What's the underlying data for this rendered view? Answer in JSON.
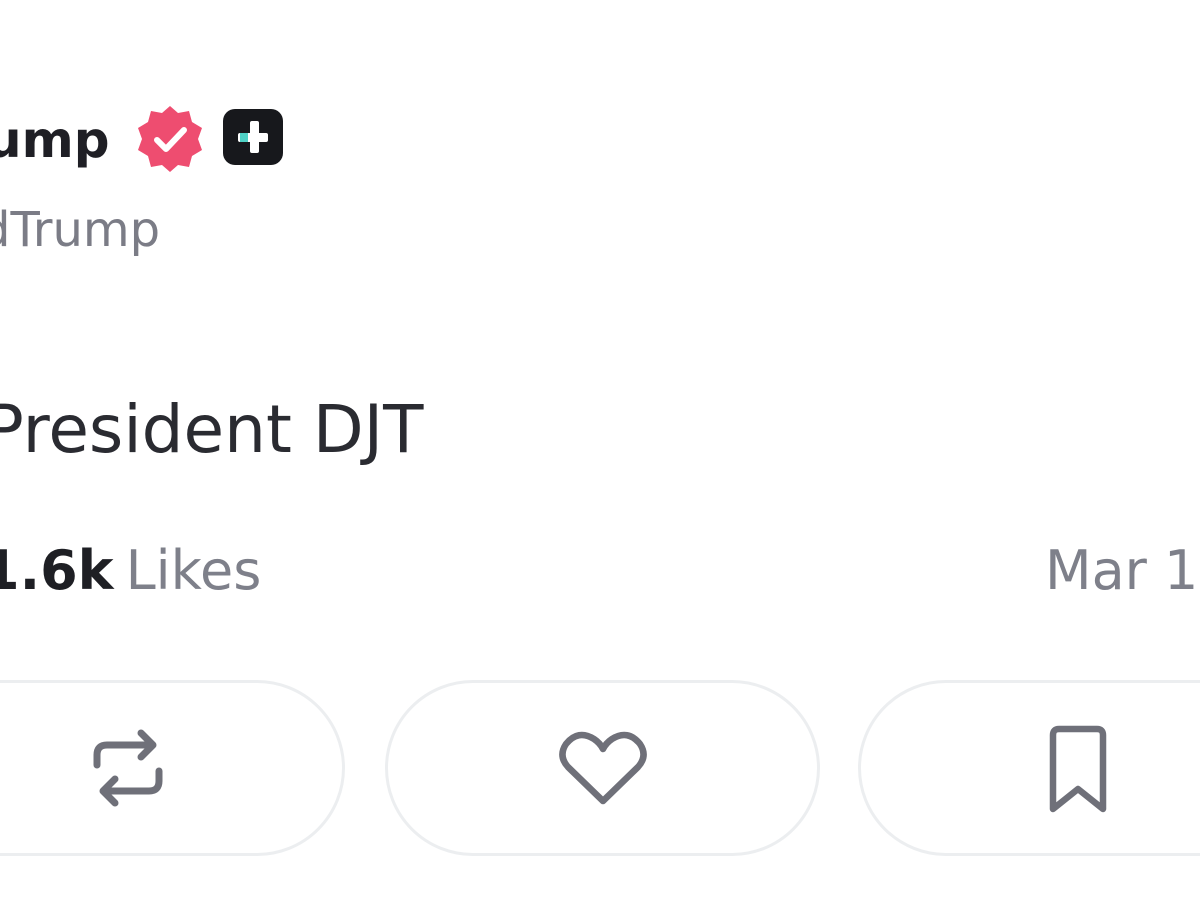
{
  "post": {
    "display_name": "ump",
    "handle": "dTrump",
    "text": "President DJT",
    "likes_count": "1.6k",
    "likes_label": "Likes",
    "timestamp": "Mar 1"
  },
  "icons": {
    "verified": "verified-badge-icon",
    "plus": "plus-badge-icon",
    "repost": "repost-icon",
    "like": "heart-icon",
    "bookmark": "bookmark-icon"
  },
  "colors": {
    "verified_badge": "#ee4d70",
    "plus_badge": "#17181c",
    "plus_accent": "#4fd1c5",
    "text_primary": "#1f1f25",
    "text_secondary": "#7b7c86",
    "pill_border": "#eceef0",
    "icon_stroke": "#6f7079"
  }
}
